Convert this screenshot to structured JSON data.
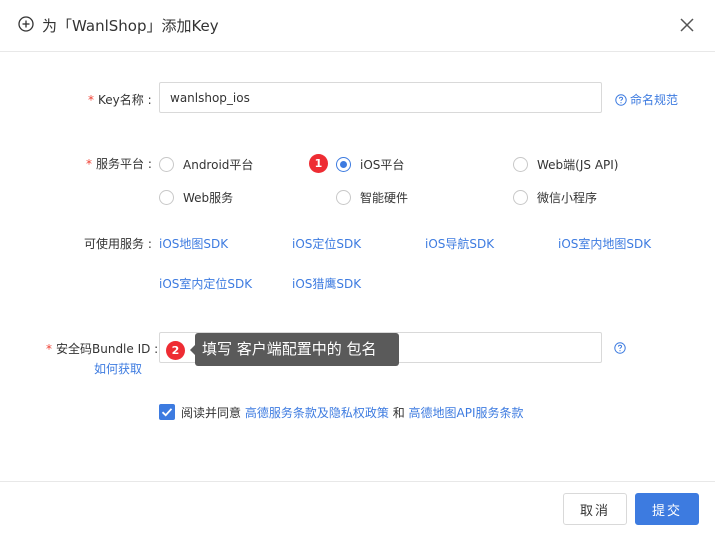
{
  "header": {
    "title": "为「WanlShop」添加Key"
  },
  "form": {
    "required_mark": "*",
    "key_name": {
      "label": "Key名称 :",
      "value": "wanlshop_ios",
      "help_link": "命名规范"
    },
    "platform": {
      "label": "服务平台 :",
      "options": [
        "Android平台",
        "iOS平台",
        "Web端(JS API)",
        "Web服务",
        "智能硬件",
        "微信小程序"
      ],
      "selected": "iOS平台"
    },
    "services": {
      "label": "可使用服务 :",
      "items": [
        "iOS地图SDK",
        "iOS定位SDK",
        "iOS导航SDK",
        "iOS室内地图SDK",
        "iOS室内定位SDK",
        "iOS猎鹰SDK"
      ]
    },
    "bundle": {
      "label": "安全码Bundle ID :",
      "how_link": "如何获取",
      "value": ""
    },
    "agreement": {
      "prefix": "阅读并同意",
      "link1": "高德服务条款及隐私权政策",
      "and": "和",
      "link2": "高德地图API服务条款",
      "checked": true
    }
  },
  "annotations": {
    "step1": "1",
    "step2": "2",
    "tooltip": "填写 客户端配置中的 包名"
  },
  "footer": {
    "cancel_label": "取消",
    "submit_label": "提交"
  },
  "colors": {
    "accent": "#3d7be0",
    "required": "#f04134",
    "step_badge": "#ee2c33",
    "tooltip_bg": "#5a5a5a"
  }
}
